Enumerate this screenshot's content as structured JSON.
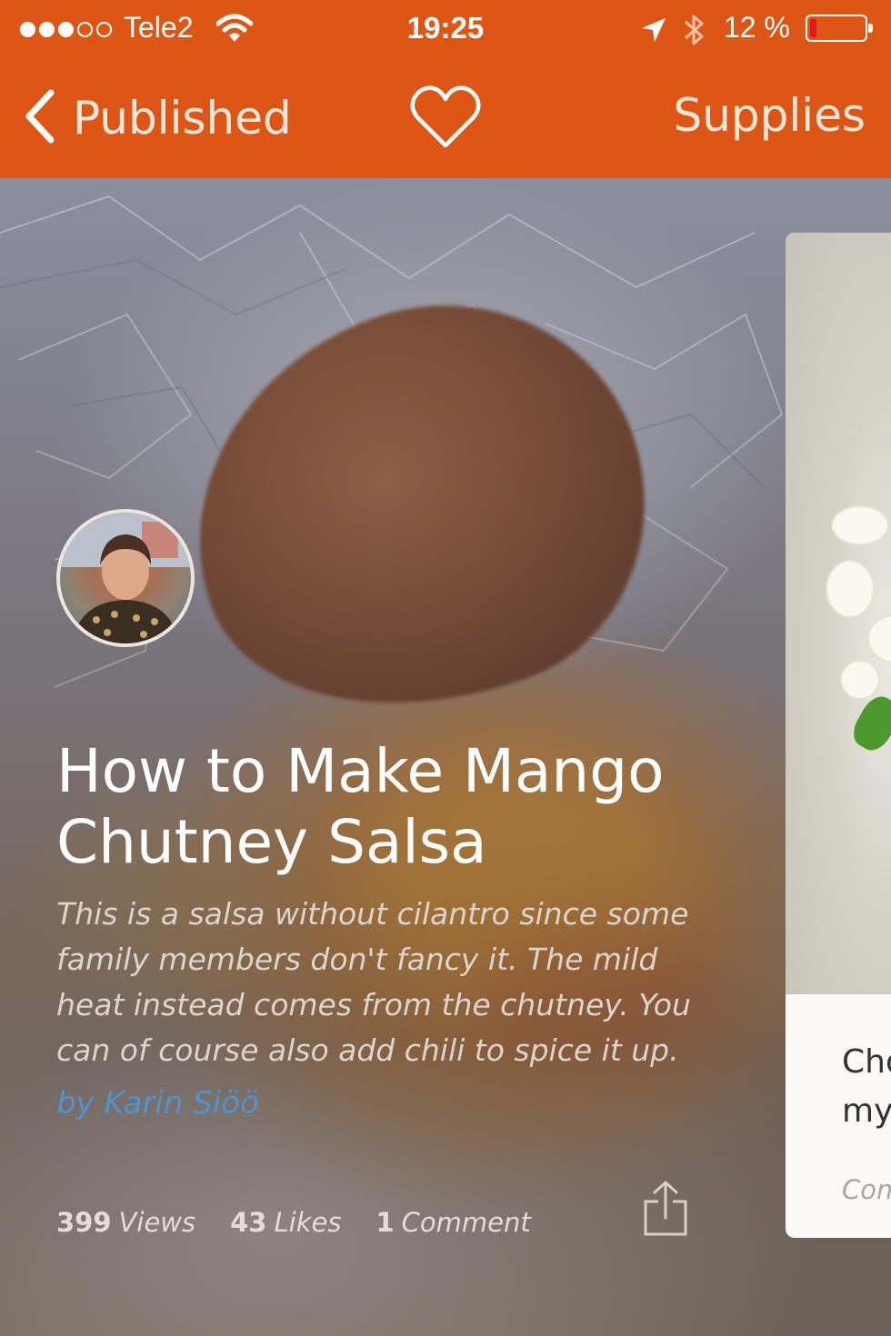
{
  "status_bar": {
    "signal_filled": 3,
    "signal_total": 5,
    "carrier": "Tele2",
    "time": "19:25",
    "battery_text": "12 %",
    "battery_level": 0.12,
    "battery_color": "#e8161c"
  },
  "nav": {
    "back_label": "Published",
    "favorite_icon": "heart-outline-icon",
    "supplies_label": "Supplies"
  },
  "guide": {
    "title": "How to Make Mango Chutney Salsa",
    "description": "This is a salsa without cilantro since some family members don't fancy it. The mild heat instead comes from the chutney. You can of course also add chili to spice it up.",
    "author": "by Karin Siöö",
    "stats": {
      "views_count": "399",
      "views_label": "Views",
      "likes_count": "43",
      "likes_label": "Likes",
      "comments_count": "1",
      "comments_label": "Comment"
    }
  },
  "next_card": {
    "text_line1": "Cho",
    "text_line2": "my",
    "comment_label": "Com"
  },
  "colors": {
    "accent": "#dd5615",
    "author_link": "#4f94d0"
  }
}
